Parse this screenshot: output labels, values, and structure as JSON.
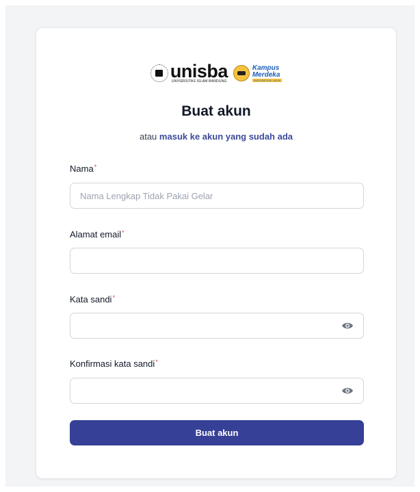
{
  "brand": {
    "wordmark": "unisba",
    "wordmark_sub": "UNIVERSITAS ISLAM BANDUNG",
    "km_line1": "Kampus",
    "km_line2": "Merdeka",
    "km_line3": "INDONESIA JAYA"
  },
  "header": {
    "title": "Buat akun",
    "subtitle_prefix": "atau",
    "login_link": "masuk ke akun yang sudah ada"
  },
  "form": {
    "name": {
      "label": "Nama",
      "required_mark": "*",
      "placeholder": "Nama Lengkap Tidak Pakai Gelar",
      "value": ""
    },
    "email": {
      "label": "Alamat email",
      "required_mark": "*",
      "placeholder": "",
      "value": ""
    },
    "password": {
      "label": "Kata sandi",
      "required_mark": "*",
      "placeholder": "",
      "value": ""
    },
    "confirm_password": {
      "label": "Konfirmasi kata sandi",
      "required_mark": "*",
      "placeholder": "",
      "value": ""
    },
    "toggle_icon": "eye-icon",
    "submit_label": "Buat akun"
  },
  "colors": {
    "primary": "#364096",
    "link": "#3b4a9b",
    "required": "#e53e3e",
    "page_bg": "#f3f4f6"
  }
}
